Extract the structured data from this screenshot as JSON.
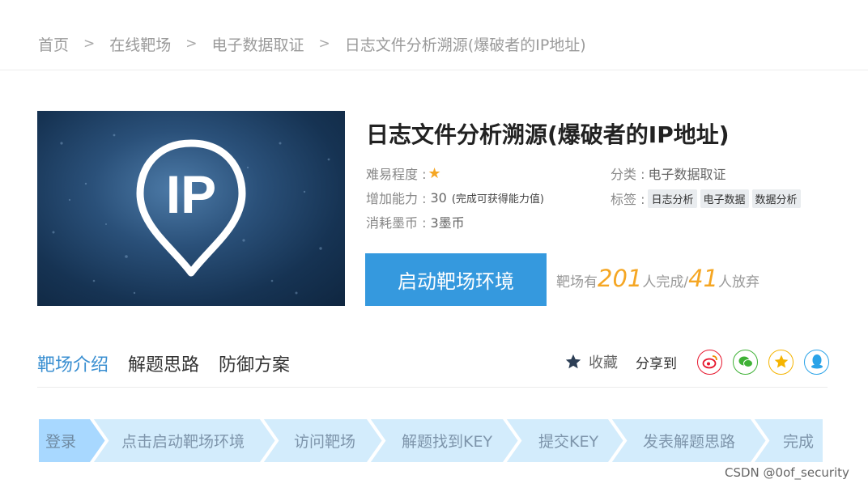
{
  "breadcrumb": {
    "items": [
      "首页",
      "在线靶场",
      "电子数据取证",
      "日志文件分析溯源(爆破者的IP地址)"
    ],
    "separator": ">"
  },
  "hero": {
    "image_text": "IP"
  },
  "challenge": {
    "title": "日志文件分析溯源(爆破者的IP地址)",
    "difficulty_label": "难易程度 :",
    "difficulty_stars": 1,
    "ability_label": "增加能力 :",
    "ability_value": "30",
    "ability_note": "(完成可获得能力值)",
    "cost_label": "消耗墨币 :",
    "cost_value": "3墨币",
    "category_label": "分类 :",
    "category_value": "电子数据取证",
    "tags_label": "标签 :",
    "tags": [
      "日志分析",
      "电子数据",
      "数据分析"
    ]
  },
  "actions": {
    "start_button": "启动靶场环境",
    "stats_prefix": "靶场有",
    "completed_count": "201",
    "completed_suffix": "人完成/",
    "abandoned_count": "41",
    "abandoned_suffix": "人放弃"
  },
  "tabs": [
    {
      "label": "靶场介绍",
      "active": true
    },
    {
      "label": "解题思路",
      "active": false
    },
    {
      "label": "防御方案",
      "active": false
    }
  ],
  "toolbar": {
    "favorite_label": "收藏",
    "share_label": "分享到",
    "share_targets": [
      "weibo-icon",
      "wechat-icon",
      "qzone-icon",
      "qq-icon"
    ]
  },
  "steps": [
    "登录",
    "点击启动靶场环境",
    "访问靶场",
    "解题找到KEY",
    "提交KEY",
    "发表解题思路",
    "完成"
  ],
  "colors": {
    "accent_blue": "#3599de",
    "link_blue": "#3a8fd1",
    "stat_orange": "#f5a623",
    "step_active": "#a8d8ff",
    "step_inactive": "#d3ecfc",
    "weibo": "#e6162d",
    "wechat": "#3eb135",
    "qzone": "#f5b400",
    "qq": "#2aa3e8"
  },
  "watermark": "CSDN @0of_security"
}
